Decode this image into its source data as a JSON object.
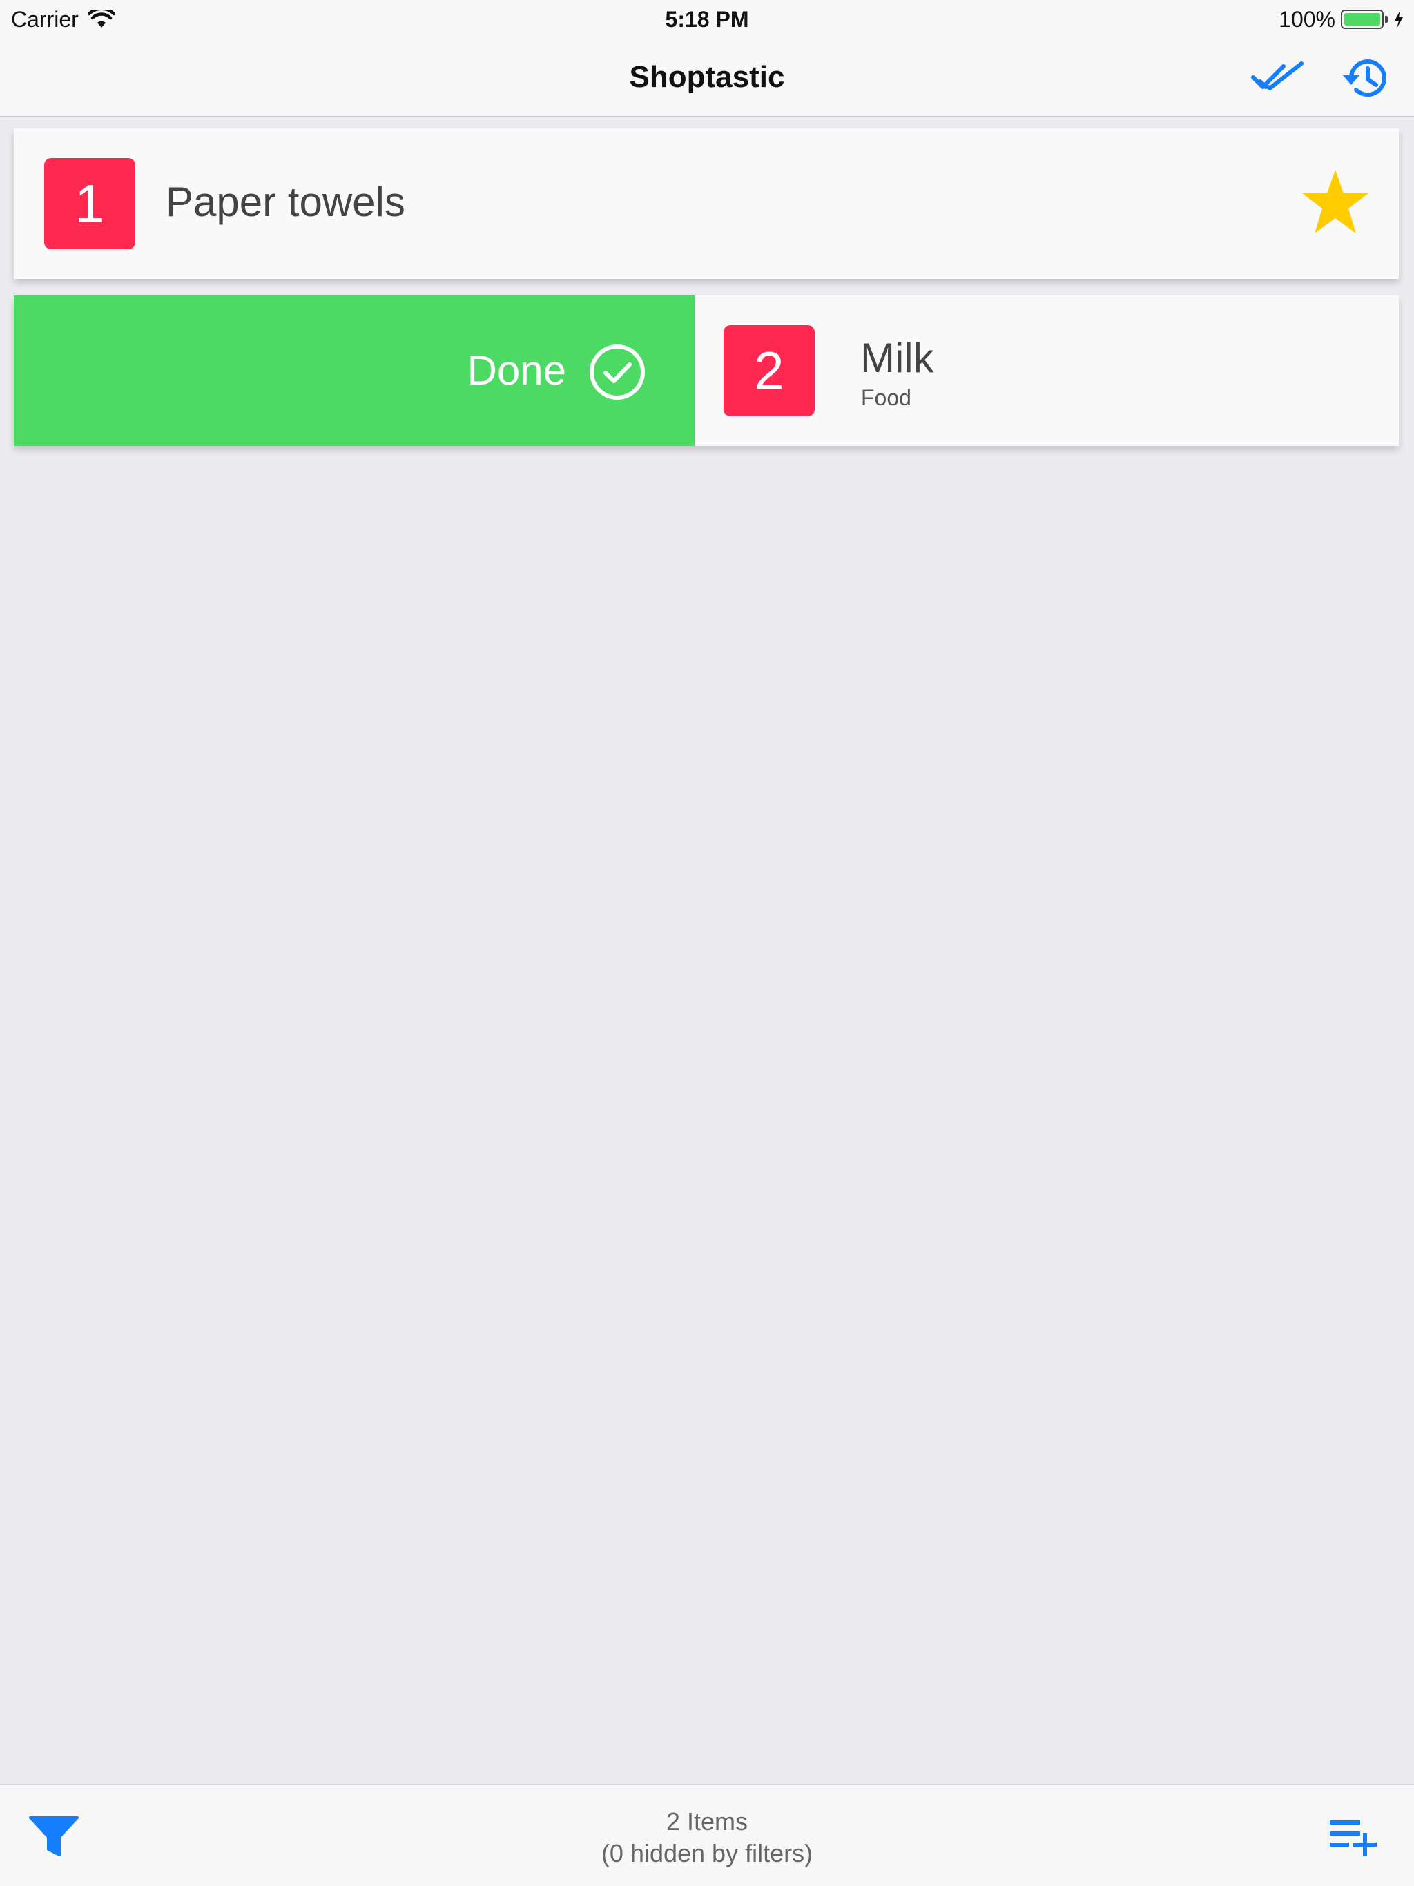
{
  "status_bar": {
    "carrier": "Carrier",
    "time": "5:18 PM",
    "battery": "100%",
    "battery_level": 1.0
  },
  "nav": {
    "title": "Shoptastic",
    "icons": [
      "double-check-icon",
      "history-icon"
    ]
  },
  "items": [
    {
      "number": "1",
      "name": "Paper towels",
      "category": "",
      "starred": true
    },
    {
      "number": "2",
      "name": "Milk",
      "category": "Food",
      "starred": false,
      "swipe_action": "Done"
    }
  ],
  "toolbar": {
    "count": "2 Items",
    "hidden": "(0 hidden by filters)",
    "icons": [
      "filter-icon",
      "add-to-list-icon"
    ]
  },
  "colors": {
    "accent": "#147efb",
    "badge": "#fe2851",
    "done": "#4cd964",
    "star": "#ffcc00",
    "background": "#ebebf0"
  }
}
